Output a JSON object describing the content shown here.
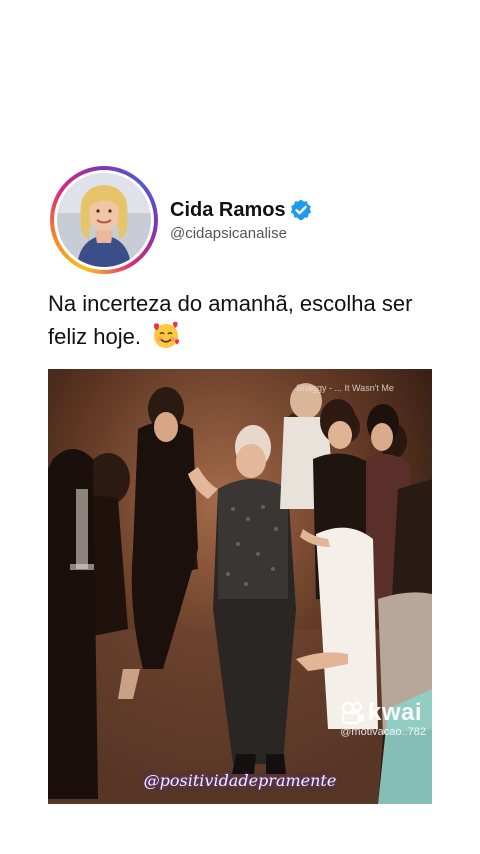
{
  "author": {
    "display_name": "Cida Ramos",
    "handle": "@cidapsicanalise",
    "verified": true,
    "avatar_icon": "profile-photo-icon",
    "verified_icon": "verified-badge-icon",
    "ring_colors": [
      "#f9c11a",
      "#f58529",
      "#dd2a7b",
      "#8134af",
      "#515bd4"
    ],
    "verified_color": "#1d9bf0"
  },
  "post": {
    "text": "Na incerteza do amanhã, escolha ser feliz hoje.",
    "emoji_icon": "smiling-face-with-hearts-icon"
  },
  "video": {
    "song_label": "Shaggy - ... It Wasn't Me",
    "platform_logo": "kwai-logo-icon",
    "platform_name": "kwai",
    "platform_user": "@motivacao..782",
    "watermark": "@positividadepramente"
  }
}
